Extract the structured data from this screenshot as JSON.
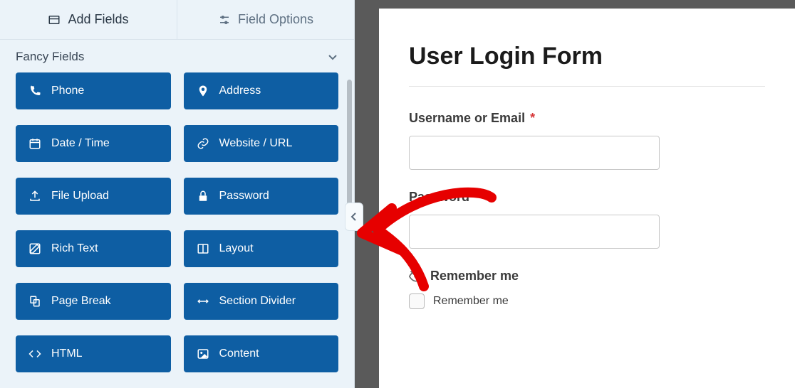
{
  "tabs": {
    "add": "Add Fields",
    "options": "Field Options"
  },
  "section": {
    "title": "Fancy Fields"
  },
  "fields": {
    "phone": "Phone",
    "address": "Address",
    "datetime": "Date / Time",
    "website": "Website / URL",
    "upload": "File Upload",
    "password": "Password",
    "richtext": "Rich Text",
    "layout": "Layout",
    "pagebreak": "Page Break",
    "sectiondivider": "Section Divider",
    "html": "HTML",
    "content": "Content"
  },
  "form": {
    "title": "User Login Form",
    "username_label": "Username or Email",
    "password_label": "Password",
    "remember_title": "Remember me",
    "remember_item": "Remember me",
    "required": "*"
  }
}
